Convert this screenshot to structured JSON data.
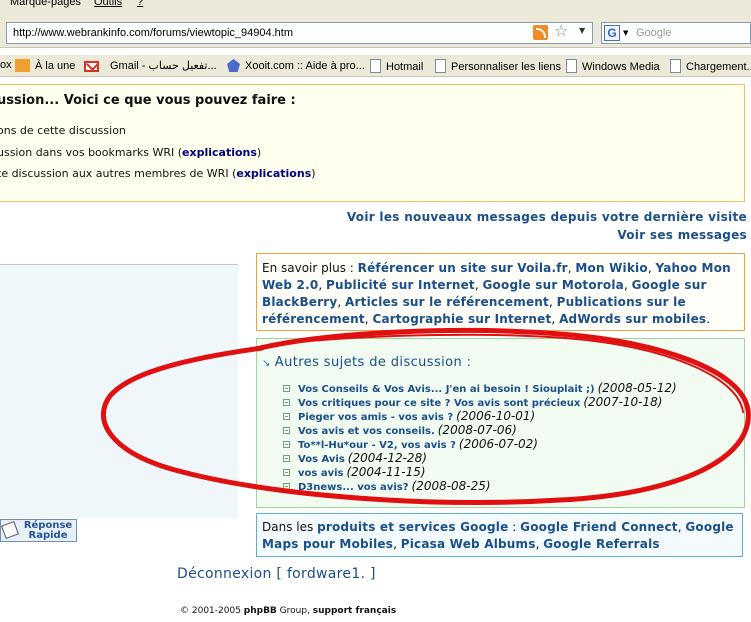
{
  "menubar": {
    "items": [
      "Marque-pages",
      "Outils",
      "?"
    ]
  },
  "navbar": {
    "url": "http://www.webrankinfo.com/forums/viewtopic_94904.htm",
    "search_placeholder": "Google",
    "search_engine_letter": "G"
  },
  "bookmarks": [
    {
      "label": "ox",
      "icon": "none"
    },
    {
      "label": "À la une",
      "icon": "rss-icon"
    },
    {
      "label": "Gmail - تفعيل حساب...",
      "icon": "gmail-icon"
    },
    {
      "label": "Xooit.com :: Aide à pro...",
      "icon": "xooit-icon"
    },
    {
      "label": "Hotmail",
      "icon": "page-icon"
    },
    {
      "label": "Personnaliser les liens",
      "icon": "page-icon"
    },
    {
      "label": "Windows Media",
      "icon": "page-icon"
    },
    {
      "label": "Chargement...",
      "icon": "page-icon"
    }
  ],
  "info": {
    "title": "ussion... Voici ce que vous pouvez faire :",
    "line1": "ons de cette discussion",
    "line2_prefix": "ussion dans vos bookmarks WRI (",
    "line2_link": "explications",
    "line2_suffix": ")",
    "line3_prefix": "te discussion aux autres membres de WRI (",
    "line3_link": "explications",
    "line3_suffix": ")"
  },
  "links": {
    "new_messages": "Voir les nouveaux messages depuis votre dernière visite",
    "my_messages": "Voir ses messages"
  },
  "quick_reply": {
    "line1": "Réponse",
    "line2": "Rapide"
  },
  "savoir": {
    "prefix": "En savoir plus : ",
    "items": [
      "Référencer un site sur Voila.fr",
      "Mon Wikio",
      "Yahoo Mon Web 2.0",
      "Publicité sur Internet",
      "Google sur Motorola",
      "Google sur BlackBerry",
      "Articles sur le référencement",
      "Publications sur le référencement",
      "Cartographie sur Internet",
      "AdWords sur mobiles"
    ],
    "sep": ", ",
    "end": "."
  },
  "topics": {
    "title": "Autres sujets de discussion :",
    "items": [
      {
        "title": "Vos Conseils & Vos Avis... J'en ai besoin ! Siouplait ;)",
        "date": "(2008-05-12)"
      },
      {
        "title": "Vos critiques pour ce site ? Vos avis sont précieux",
        "date": "(2007-10-18)"
      },
      {
        "title": "Pieger vos amis - vos avis ?",
        "date": "(2006-10-01)"
      },
      {
        "title": "Vos avis et vos conseils.",
        "date": "(2008-07-06)"
      },
      {
        "title": "To**l-Hu*our - V2, vos avis ?",
        "date": "(2006-07-02)"
      },
      {
        "title": "Vos Avis",
        "date": "(2004-12-28)"
      },
      {
        "title": "vos avis",
        "date": "(2004-11-15)"
      },
      {
        "title": "D3news... vos avis?",
        "date": "(2008-08-25)"
      }
    ]
  },
  "google_box": {
    "prefix": "Dans les ",
    "category": "produits et services Google",
    "colon": " : ",
    "items": [
      "Google Friend Connect",
      "Google Maps pour Mobiles",
      "Picasa Web Albums",
      "Google Referrals"
    ],
    "sep": ", "
  },
  "logout": "Déconnexion [ fordware1. ]",
  "footer": {
    "copy": "© 2001-2005 ",
    "phpbb": "phpBB",
    "group": " Group, ",
    "support": "support français"
  },
  "colors": {
    "link": "#1a4f8a",
    "annotation": "#e01010"
  }
}
